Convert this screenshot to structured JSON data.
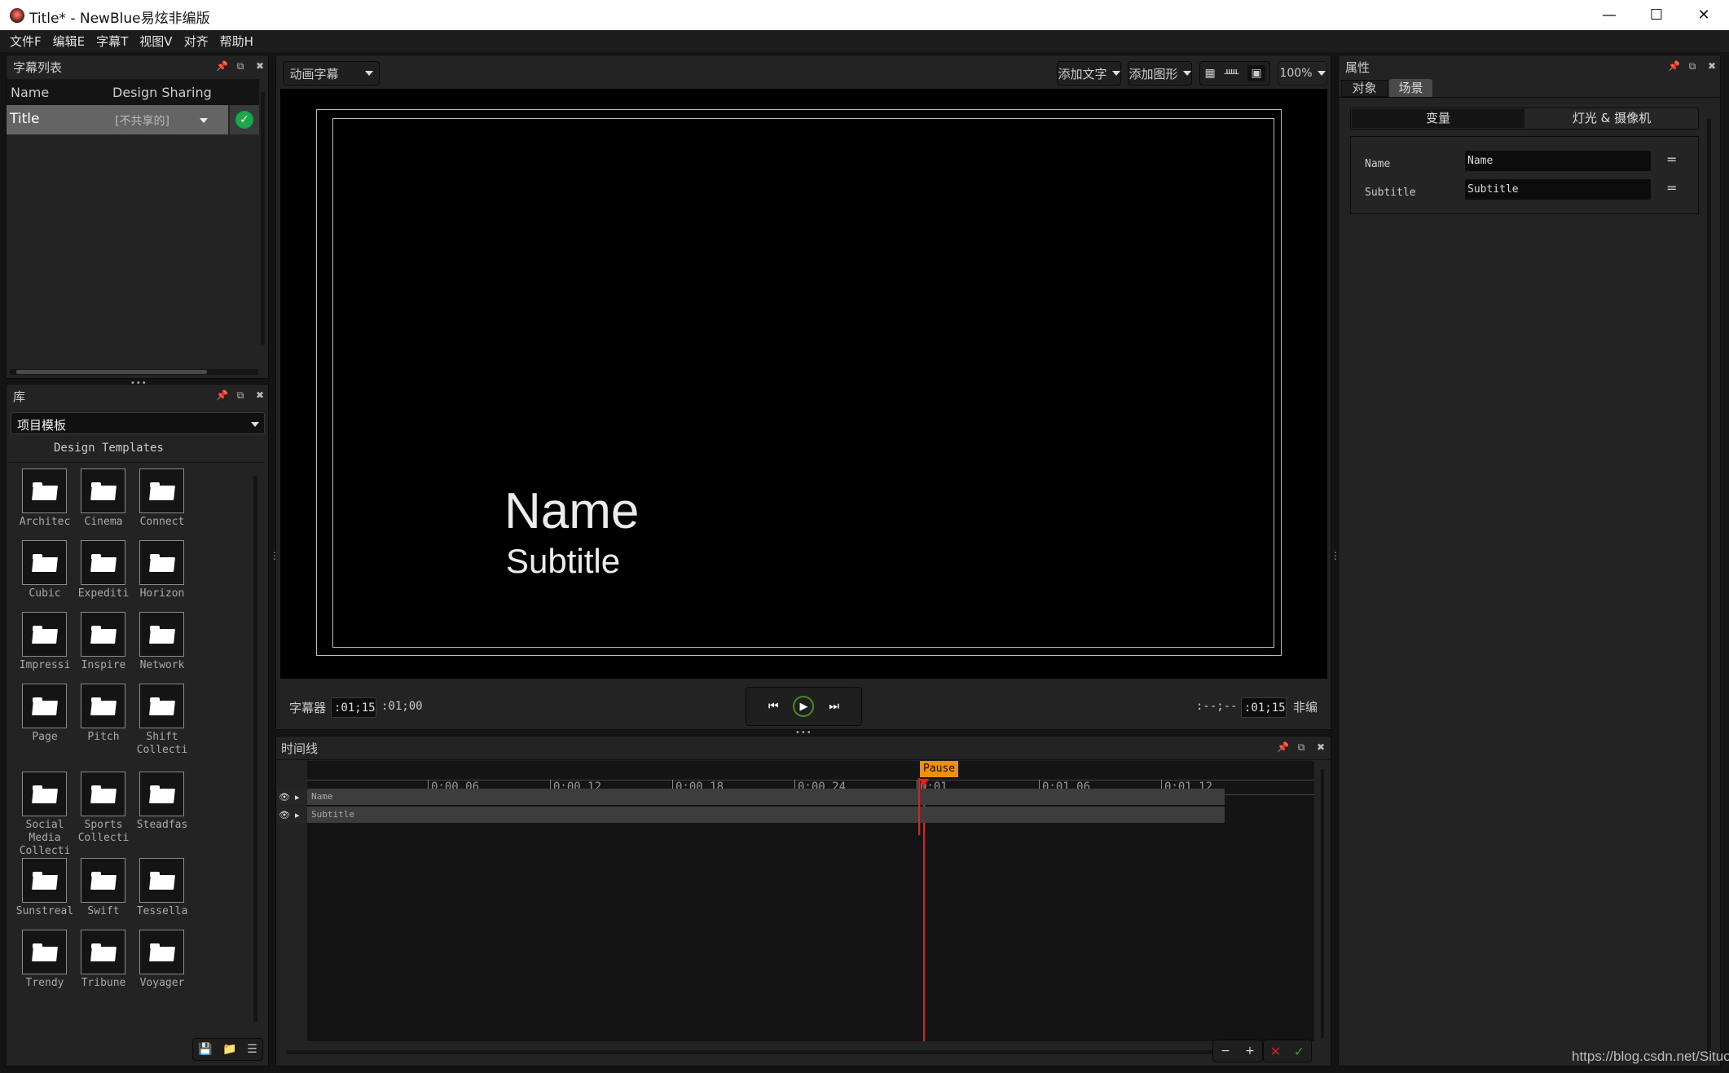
{
  "window": {
    "title": "Title* - NewBlue易炫非编版",
    "controls": {
      "minimize": "—",
      "maximize": "☐",
      "close": "✕"
    }
  },
  "menu": [
    "文件F",
    "编辑E",
    "字幕T",
    "视图V",
    "对齐",
    "帮助H"
  ],
  "title_list_panel": {
    "title": "字幕列表",
    "columns": [
      "Name",
      "Design Sharing"
    ],
    "rows": [
      {
        "name": "Title",
        "sharing": "[不共享的]",
        "status": "checked"
      }
    ]
  },
  "library_panel": {
    "title": "库",
    "dropdown_value": "项目模板",
    "section_title": "Design Templates",
    "templates": [
      "Architec",
      "Cinema",
      "Connect",
      "Cubic",
      "Expediti",
      "Horizon",
      "Impressi",
      "Inspire",
      "Network",
      "Page",
      "Pitch",
      "Shift Collecti",
      "Social Media Collecti Vol",
      "Sports Collecti",
      "Steadfas",
      "Sunstreal",
      "Swift",
      "Tessella",
      "Trendy",
      "Tribune",
      "Voyager"
    ],
    "footer_icons": [
      "save-template-icon",
      "add-folder-icon",
      "list-view-icon"
    ]
  },
  "toolbar": {
    "mode_dropdown": "动画字幕",
    "add_text": "添加文字",
    "add_shape": "添加图形",
    "view_icons": [
      "grid-icon",
      "ruler-icon",
      "safe-area-icon"
    ],
    "zoom": "100%"
  },
  "canvas": {
    "name_text": "Name",
    "subtitle_text": "Subtitle"
  },
  "transport": {
    "label": "字幕器",
    "duration": ":01;15",
    "current_time": ":01;00",
    "in_point": ":--;--",
    "out_point": ":01;15",
    "right_label": "非编"
  },
  "timeline": {
    "title": "时间线",
    "marker_label": "Pause",
    "ruler_labels": [
      "0:00.06",
      "0:00.12",
      "0:00.18",
      "0:00.24",
      "0:01",
      "0:01.06",
      "0:01.12"
    ],
    "tracks": [
      "Name",
      "Subtitle"
    ],
    "buttons": {
      "zoom_out": "−",
      "zoom_in": "+",
      "cancel": "✕",
      "confirm": "✓"
    }
  },
  "properties_panel": {
    "title": "属性",
    "tabs": [
      "对象",
      "场景"
    ],
    "active_tab": "场景",
    "subtabs": [
      "变量",
      "灯光 & 摄像机"
    ],
    "active_subtab": "变量",
    "variables": [
      {
        "label": "Name",
        "value": "Name"
      },
      {
        "label": "Subtitle",
        "value": "Subtitle"
      }
    ]
  },
  "watermark": "https://blog.csdn.net/Situo",
  "colors": {
    "playhead": "#e02020",
    "marker": "#f0900a",
    "check_green": "#1fa64a",
    "play_ring": "#4a8a1c"
  }
}
